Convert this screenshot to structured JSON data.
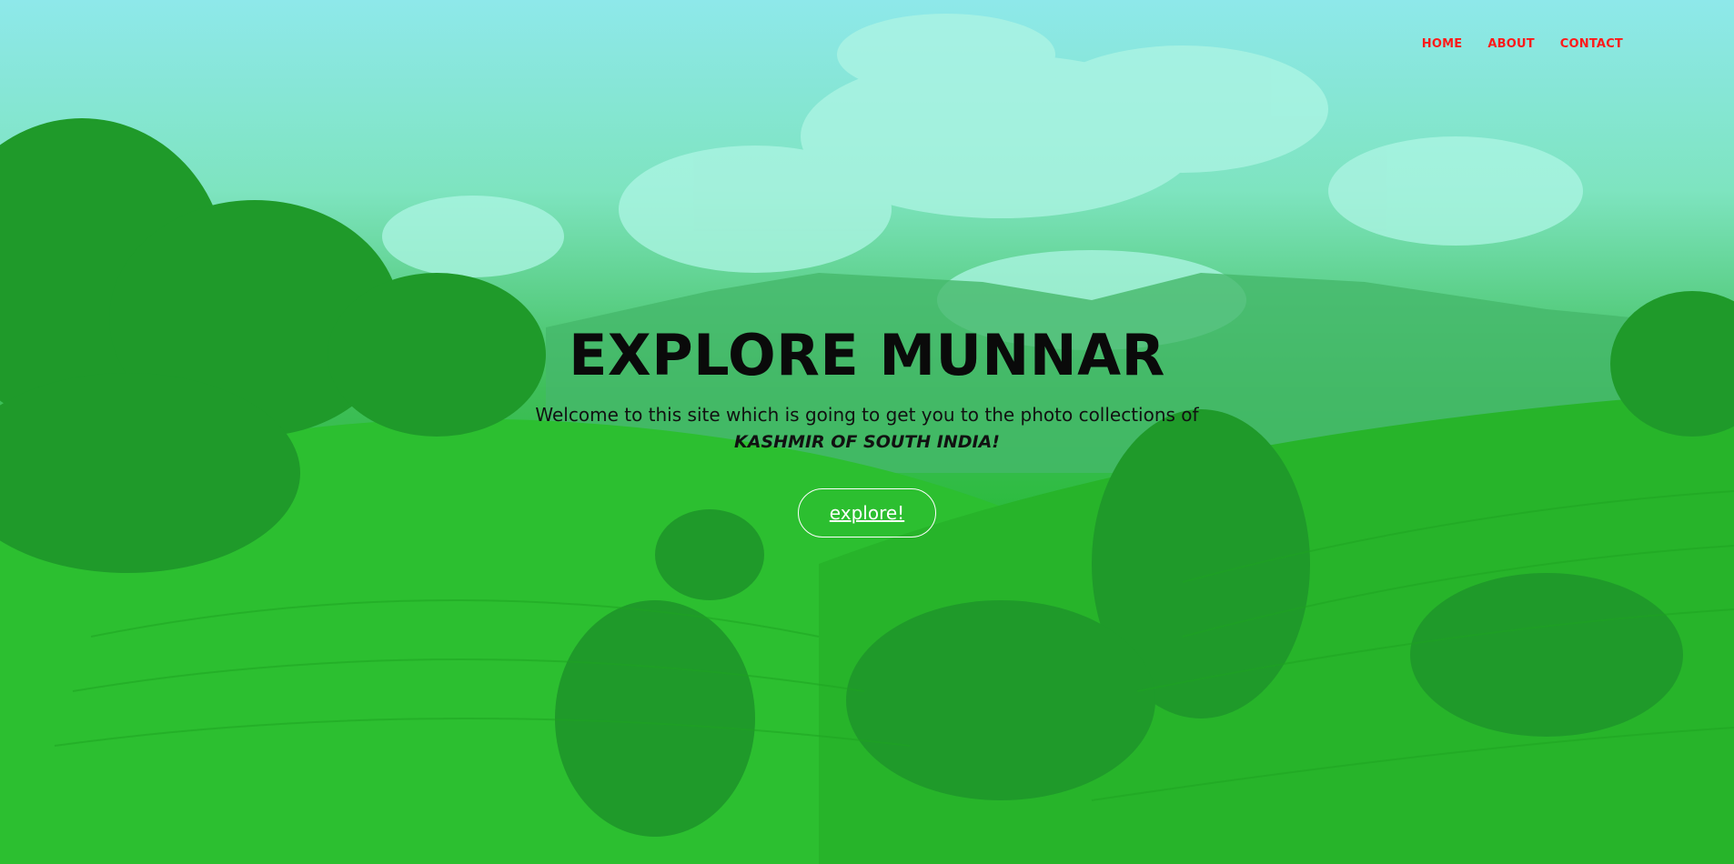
{
  "nav": {
    "items": [
      {
        "label": "HOME"
      },
      {
        "label": "ABOUT"
      },
      {
        "label": "CONTACT"
      }
    ]
  },
  "hero": {
    "title": "EXPLORE MUNNAR",
    "subtitle": "Welcome to this site which is going to get you to the photo collections of",
    "highlight": "KASHMIR OF SOUTH INDIA!",
    "button_label": "explore!"
  },
  "colors": {
    "nav_link": "#ff1a1a",
    "overlay_green": "#16b51e",
    "sky": "#8ee8ea"
  }
}
